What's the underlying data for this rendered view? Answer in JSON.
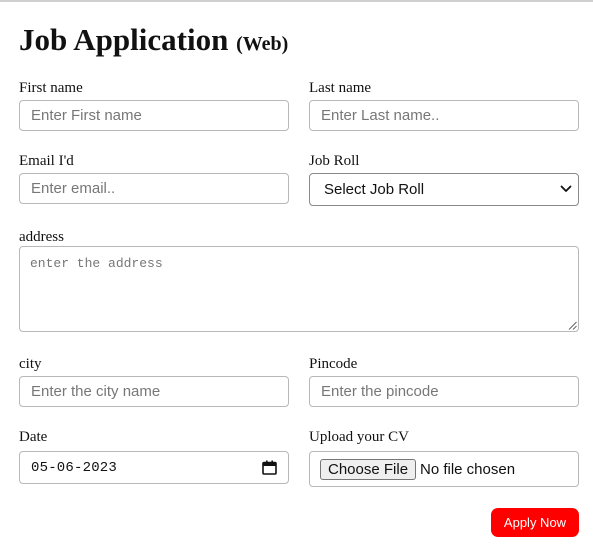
{
  "form": {
    "title": "Job Application",
    "subtitle": "(Web)",
    "first_name": {
      "label": "First name",
      "placeholder": "Enter First name",
      "value": ""
    },
    "last_name": {
      "label": "Last name",
      "placeholder": "Enter Last name..",
      "value": ""
    },
    "email": {
      "label": "Email I'd",
      "placeholder": "Enter email..",
      "value": ""
    },
    "job_role": {
      "label": "Job Roll",
      "selected": "Select Job Roll"
    },
    "address": {
      "label": "address",
      "placeholder": "enter the address",
      "value": ""
    },
    "city": {
      "label": "city",
      "placeholder": "Enter the city name",
      "value": ""
    },
    "pincode": {
      "label": "Pincode",
      "placeholder": "Enter the pincode",
      "value": ""
    },
    "date": {
      "label": "Date",
      "value": "05-06-2023"
    },
    "cv": {
      "label": "Upload your CV",
      "button_label": "Choose File",
      "status": "No file chosen"
    },
    "submit_label": "Apply Now"
  },
  "colors": {
    "accent": "#ff0000",
    "border": "#b8b8b8",
    "text": "#111111"
  },
  "icons": {
    "select_arrow": "chevron-down-icon",
    "date_picker": "calendar-icon",
    "textarea_resize": "resize-grip-icon"
  }
}
